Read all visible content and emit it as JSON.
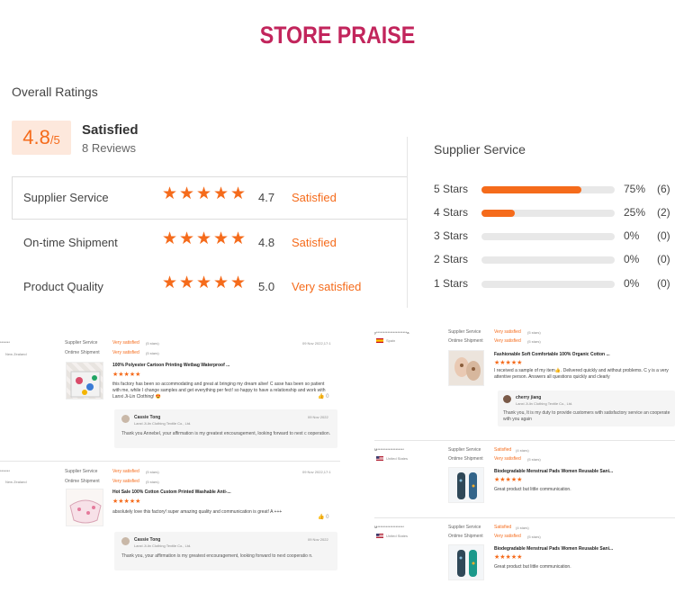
{
  "title": "STORE PRAISE",
  "overall": {
    "label": "Overall Ratings",
    "score": "4.8",
    "score_max": "/5",
    "satisfaction": "Satisfied",
    "reviews": "8 Reviews"
  },
  "ratings": [
    {
      "label": "Supplier Service",
      "value": "4.7",
      "text": "Satisfied",
      "stars": 4.7
    },
    {
      "label": "On-time Shipment",
      "value": "4.8",
      "text": "Satisfied",
      "stars": 4.8
    },
    {
      "label": "Product Quality",
      "value": "5.0",
      "text": "Very satisfied",
      "stars": 5.0
    }
  ],
  "supplier_service": {
    "title": "Supplier Service",
    "rows": [
      {
        "label": "5 Stars",
        "pct": "75%",
        "count": "(6)",
        "fill": 0.75
      },
      {
        "label": "4 Stars",
        "pct": "25%",
        "count": "(2)",
        "fill": 0.25
      },
      {
        "label": "3 Stars",
        "pct": "0%",
        "count": "(0)",
        "fill": 0
      },
      {
        "label": "2 Stars",
        "pct": "0%",
        "count": "(0)",
        "fill": 0
      },
      {
        "label": "1 Stars",
        "pct": "0%",
        "count": "(0)",
        "fill": 0
      }
    ]
  },
  "reviews_left": [
    {
      "user": "*******",
      "country": "New Zealand",
      "supplier_label": "Supplier Service",
      "supplier_sat": "Very satisfied",
      "supplier_cnt": "(5 stars)",
      "shipment_label": "Ontime Shipment",
      "shipment_sat": "Very satisfied",
      "shipment_cnt": "(5 stars)",
      "date": "09 Nov 2022,17:1",
      "product": "100% Polyester Cartoon Printing Wetbag Waterproof ...",
      "body": "this factory has been so accommodating and great at bringing my dream alive! C asse has been so patient with me, while I change samples and get everything per fect! so happy to have a relationship and work with Lanxi Ji-Lin Clothing! 😍",
      "likes": "0",
      "reply_name": "Cassie Tong",
      "reply_company": "Lanxi Ji-lin Clothing Textile Co., Ltd.",
      "reply_date": "09 Nov 2022",
      "reply_text": "Thank you Annebel, your affirmation is my greatest encouragement, looking forward to next c ooperation."
    },
    {
      "user": "*******",
      "country": "New Zealand",
      "supplier_label": "Supplier Service",
      "supplier_sat": "Very satisfied",
      "supplier_cnt": "(5 stars)",
      "shipment_label": "Ontime Shipment",
      "shipment_sat": "Very satisfied",
      "shipment_cnt": "(5 stars)",
      "date": "09 Nov 2022,17:1",
      "product": "Hot Sale 100% Cotton Custom Printed Washable Anti-...",
      "body": "absolutely love this factory! super amazing quality and communication is great! A +++",
      "likes": "0",
      "reply_name": "Cassie Tong",
      "reply_company": "Lanxi Ji-lin Clothing Textile Co., Ltd.",
      "reply_date": "09 Nov 2022",
      "reply_text": "Thank you, your affirmation is my greatest encouragement, looking forward to next cooperatio n."
    }
  ],
  "reviews_right": [
    {
      "user": "y**********************a",
      "country": "Spain",
      "supplier_label": "Supplier Service",
      "supplier_sat": "Very satisfied",
      "supplier_cnt": "(5 stars)",
      "shipment_label": "Ontime Shipment",
      "shipment_sat": "Very satisfied",
      "shipment_cnt": "(5 stars)",
      "product": "Fashionable Soft Comfortable 100% Organic Cotton ...",
      "body": "I received a sample of my item👍. Delivered quickly and without problems. C y is a very attentive person. Answers all questions quickly and clearly",
      "reply_name": "cherry jiang",
      "reply_company": "Lanxi Ji-lin Clothing Textile Co., Ltd.",
      "reply_text": "Thank you, It is my duty to provide customers with satisfactory service an cooperate with you again"
    },
    {
      "user": "M*******************",
      "country": "United States",
      "supplier_label": "Supplier Service",
      "supplier_sat": "Satisfied",
      "supplier_cnt": "(4 stars)",
      "shipment_label": "Ontime Shipment",
      "shipment_sat": "Very satisfied",
      "shipment_cnt": "(5 stars)",
      "product": "Biodegradable Menstrual Pads Women Reusable Sani...",
      "body": "Great product but little communication."
    },
    {
      "user": "M*******************",
      "country": "United States",
      "supplier_label": "Supplier Service",
      "supplier_sat": "Satisfied",
      "supplier_cnt": "(4 stars)",
      "shipment_label": "Ontime Shipment",
      "shipment_sat": "Very satisfied",
      "shipment_cnt": "(5 stars)",
      "product": "Biodegradable Menstrual Pads Women Reusable Sani...",
      "body": "Great product but little communication."
    }
  ],
  "colors": {
    "accent": "#f56b1b",
    "title": "#c2255c",
    "score_bg": "#fde8dc"
  },
  "icons": {
    "star": "star-icon",
    "like": "thumbs-up-icon"
  }
}
